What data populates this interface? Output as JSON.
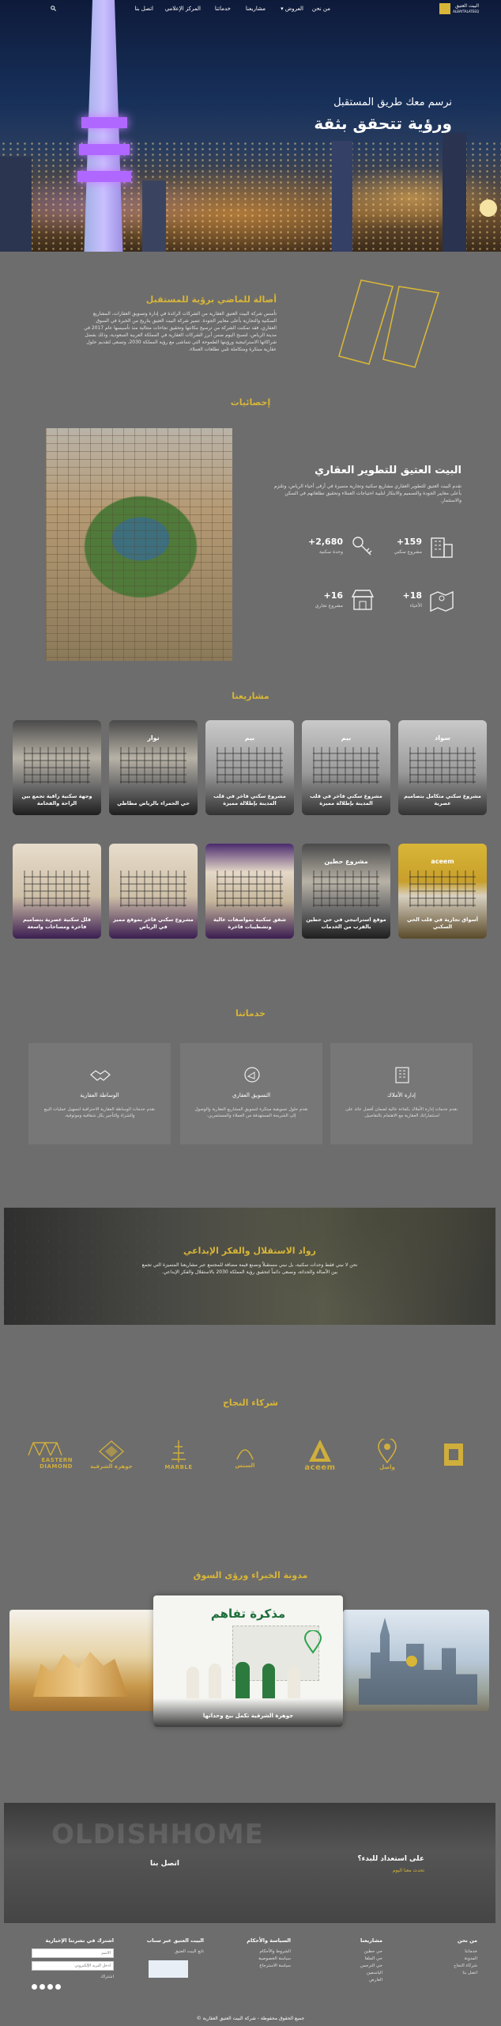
{
  "nav": {
    "logo_line1": "البيت العتيق",
    "logo_line2": "ALBAYTALATEEQ",
    "items": [
      "من نحن",
      "العروض",
      "مشاريعنا",
      "خدماتنا",
      "المركز الإعلامي",
      "اتصل بنا"
    ],
    "search_icon": "search-icon",
    "dropdown_icon": "chevron-down-icon"
  },
  "hero": {
    "subtitle": "نرسم معك طريق المستقبل",
    "title": "ورؤية تتحقق بثقة"
  },
  "about": {
    "title": "أصالة للماضي برؤية للمستقبل",
    "text": "تأسس شركة البيت العتيق العقارية من الشركات الرائدة في إدارة وتسويق العقارات، المشاريع السكنية والتجارية بأعلى معايير الجودة. تتميز شركة البيت العتيق بتاريخ من الخبرة في السوق العقاري، فقد تمكنت الشركة من ترسيخ مكانتها وتحقيق نجاحات متتالية منذ تأسيسها عام 2017 في مدينة الرياض، لتصبح اليوم ضمن أبرز الشركات العقارية في المملكة العربية السعودية، وذلك بفضل شراكاتها الاستراتيجية ورؤيتها الطموحة التي تتماشى مع رؤية المملكة 2030، وتسعى لتقديم حلول عقارية مبتكرة ومتكاملة تلبي تطلعات العملاء."
  },
  "stats": {
    "title": "إحصائيات",
    "heading": "البيت العتيق للتطوير العقاري",
    "text": "تقدم البيت العتيق للتطوير العقاري مشاريع سكنية وتجارية متميزة في أرقى أحياء الرياض، وتلتزم بأعلى معايير الجودة والتصميم والابتكار لتلبية احتياجات العملاء وتحقيق تطلعاتهم في السكن والاستثمار.",
    "items": [
      {
        "value": "159+",
        "label": "مشروع سكني",
        "icon": "building-icon"
      },
      {
        "value": "2,680+",
        "label": "وحدة سكنية",
        "icon": "key-icon"
      },
      {
        "value": "18+",
        "label": "الأحياء",
        "icon": "map-pin-icon"
      },
      {
        "value": "16+",
        "label": "مشروع تجاري",
        "icon": "store-icon"
      }
    ]
  },
  "projects": {
    "title": "مشاريعنا",
    "row1": [
      {
        "brand": "",
        "caption": "وجهة سكنية راقية تجمع بين الراحة والفخامة"
      },
      {
        "brand": "نوار",
        "caption": "حي الحمراء بالرياض مطاطي"
      },
      {
        "brand": "بيم",
        "caption": "مشروع سكني فاخر في قلب المدينة بإطلالة مميزة"
      },
      {
        "brand": "بيم",
        "caption": "مشروع سكني فاخر في قلب المدينة بإطلالة مميزة"
      },
      {
        "brand": "سواد",
        "caption": "مشروع سكني متكامل بتصاميم عصرية"
      }
    ],
    "row2": [
      {
        "brand": "",
        "caption": "فلل سكنية عصرية بتصاميم فاخرة ومساحات واسعة"
      },
      {
        "brand": "",
        "caption": "مشروع سكني فاخر بموقع مميز في الرياض"
      },
      {
        "brand": "",
        "caption": "شقق سكنية بمواصفات عالية وتشطيبات فاخرة"
      },
      {
        "brand": "مشروع حطين",
        "caption": "موقع استراتيجي في حي حطين بالقرب من الخدمات"
      },
      {
        "brand": "aceem",
        "caption": "أسواق تجارية في قلب الحي السكني"
      }
    ]
  },
  "services": {
    "title": "خدماتنا",
    "items": [
      {
        "icon": "building-icon",
        "title": "إدارة الأملاك",
        "desc": "نقدم خدمات إدارة الأملاك بكفاءة عالية لضمان أفضل عائد على استثماراتك العقارية مع الاهتمام بالتفاصيل."
      },
      {
        "icon": "megaphone-icon",
        "title": "التسويق العقاري",
        "desc": "نقدم حلول تسويقية مبتكرة لتسويق المشاريع العقارية والوصول إلى الشريحة المستهدفة من العملاء والمستثمرين."
      },
      {
        "icon": "handshake-icon",
        "title": "الوساطة العقارية",
        "desc": "نقدم خدمات الوساطة العقارية الاحترافية لتسهيل عمليات البيع والشراء والتأجير بكل شفافية وموثوقية."
      }
    ]
  },
  "banner": {
    "title": "رواد الاستقلال والفكر الإبداعي",
    "text": "نحن لا نبني فقط وحدات سكنية، بل نبني مستقبلاً ونصنع قيمة مضافة للمجتمع عبر مشاريعنا المتميزة التي تجمع بين الأصالة والحداثة، ونسعى دائماً لتحقيق رؤية المملكة 2030 بالاستقلال والفكر الإبداعي."
  },
  "partners": {
    "title": "شركاء النجاح",
    "items": [
      {
        "name": "EASTERN DIAMOND",
        "icon": "diamond-logo-icon"
      },
      {
        "name": "جوهرة الشرقية",
        "icon": "rhombus-logo-icon"
      },
      {
        "name": "MARBLE",
        "icon": "tower-logo-icon"
      },
      {
        "name": "السنس",
        "icon": "sans-logo-icon"
      },
      {
        "name": "aceem",
        "icon": "aceem-logo-icon"
      },
      {
        "name": "واصل",
        "icon": "pin-logo-icon"
      },
      {
        "name": "",
        "icon": "square-logo-icon"
      }
    ]
  },
  "blog": {
    "title": "مدونة الخبراء ورؤى السوق",
    "center_heading": "مذكرة تفاهم",
    "center_caption": "جوهرة الشرقية تكمل بيع وحداتها"
  },
  "cta": {
    "title": "على استعداد للبدء؟",
    "subtitle": "تحدث معنا اليوم",
    "button": "اتصل بنا",
    "watermark": "OLDISHHOME"
  },
  "footer": {
    "columns": [
      {
        "heading": "من نحن",
        "links": [
          "خدماتنا",
          "المدونة",
          "شركاء النجاح",
          "اتصل بنا"
        ]
      },
      {
        "heading": "مشاريعنا",
        "links": [
          "حي حطين",
          "حي الملقا",
          "حي النرجس",
          "الياسمين",
          "العارض"
        ]
      },
      {
        "heading": "السياسة والأحكام",
        "links": [
          "الشروط والأحكام",
          "سياسة الخصوصية",
          "سياسة الاسترجاع"
        ]
      },
      {
        "heading": "البيت العتيق عبر سناب",
        "links": [
          "تابع البيت العتيق"
        ]
      },
      {
        "heading": "اشترك في نشرتنا الإخبارية",
        "links": []
      }
    ],
    "newsletter_name_placeholder": "الاسم",
    "newsletter_email_placeholder": "أدخل البريد الإلكتروني",
    "subscribe": "اشتراك",
    "copyright": "جميع الحقوق محفوظة - شركة البيت العتيق العقارية ©"
  },
  "colors": {
    "accent": "#d8b637",
    "bg": "#6d6d6d",
    "card": "#777777"
  }
}
